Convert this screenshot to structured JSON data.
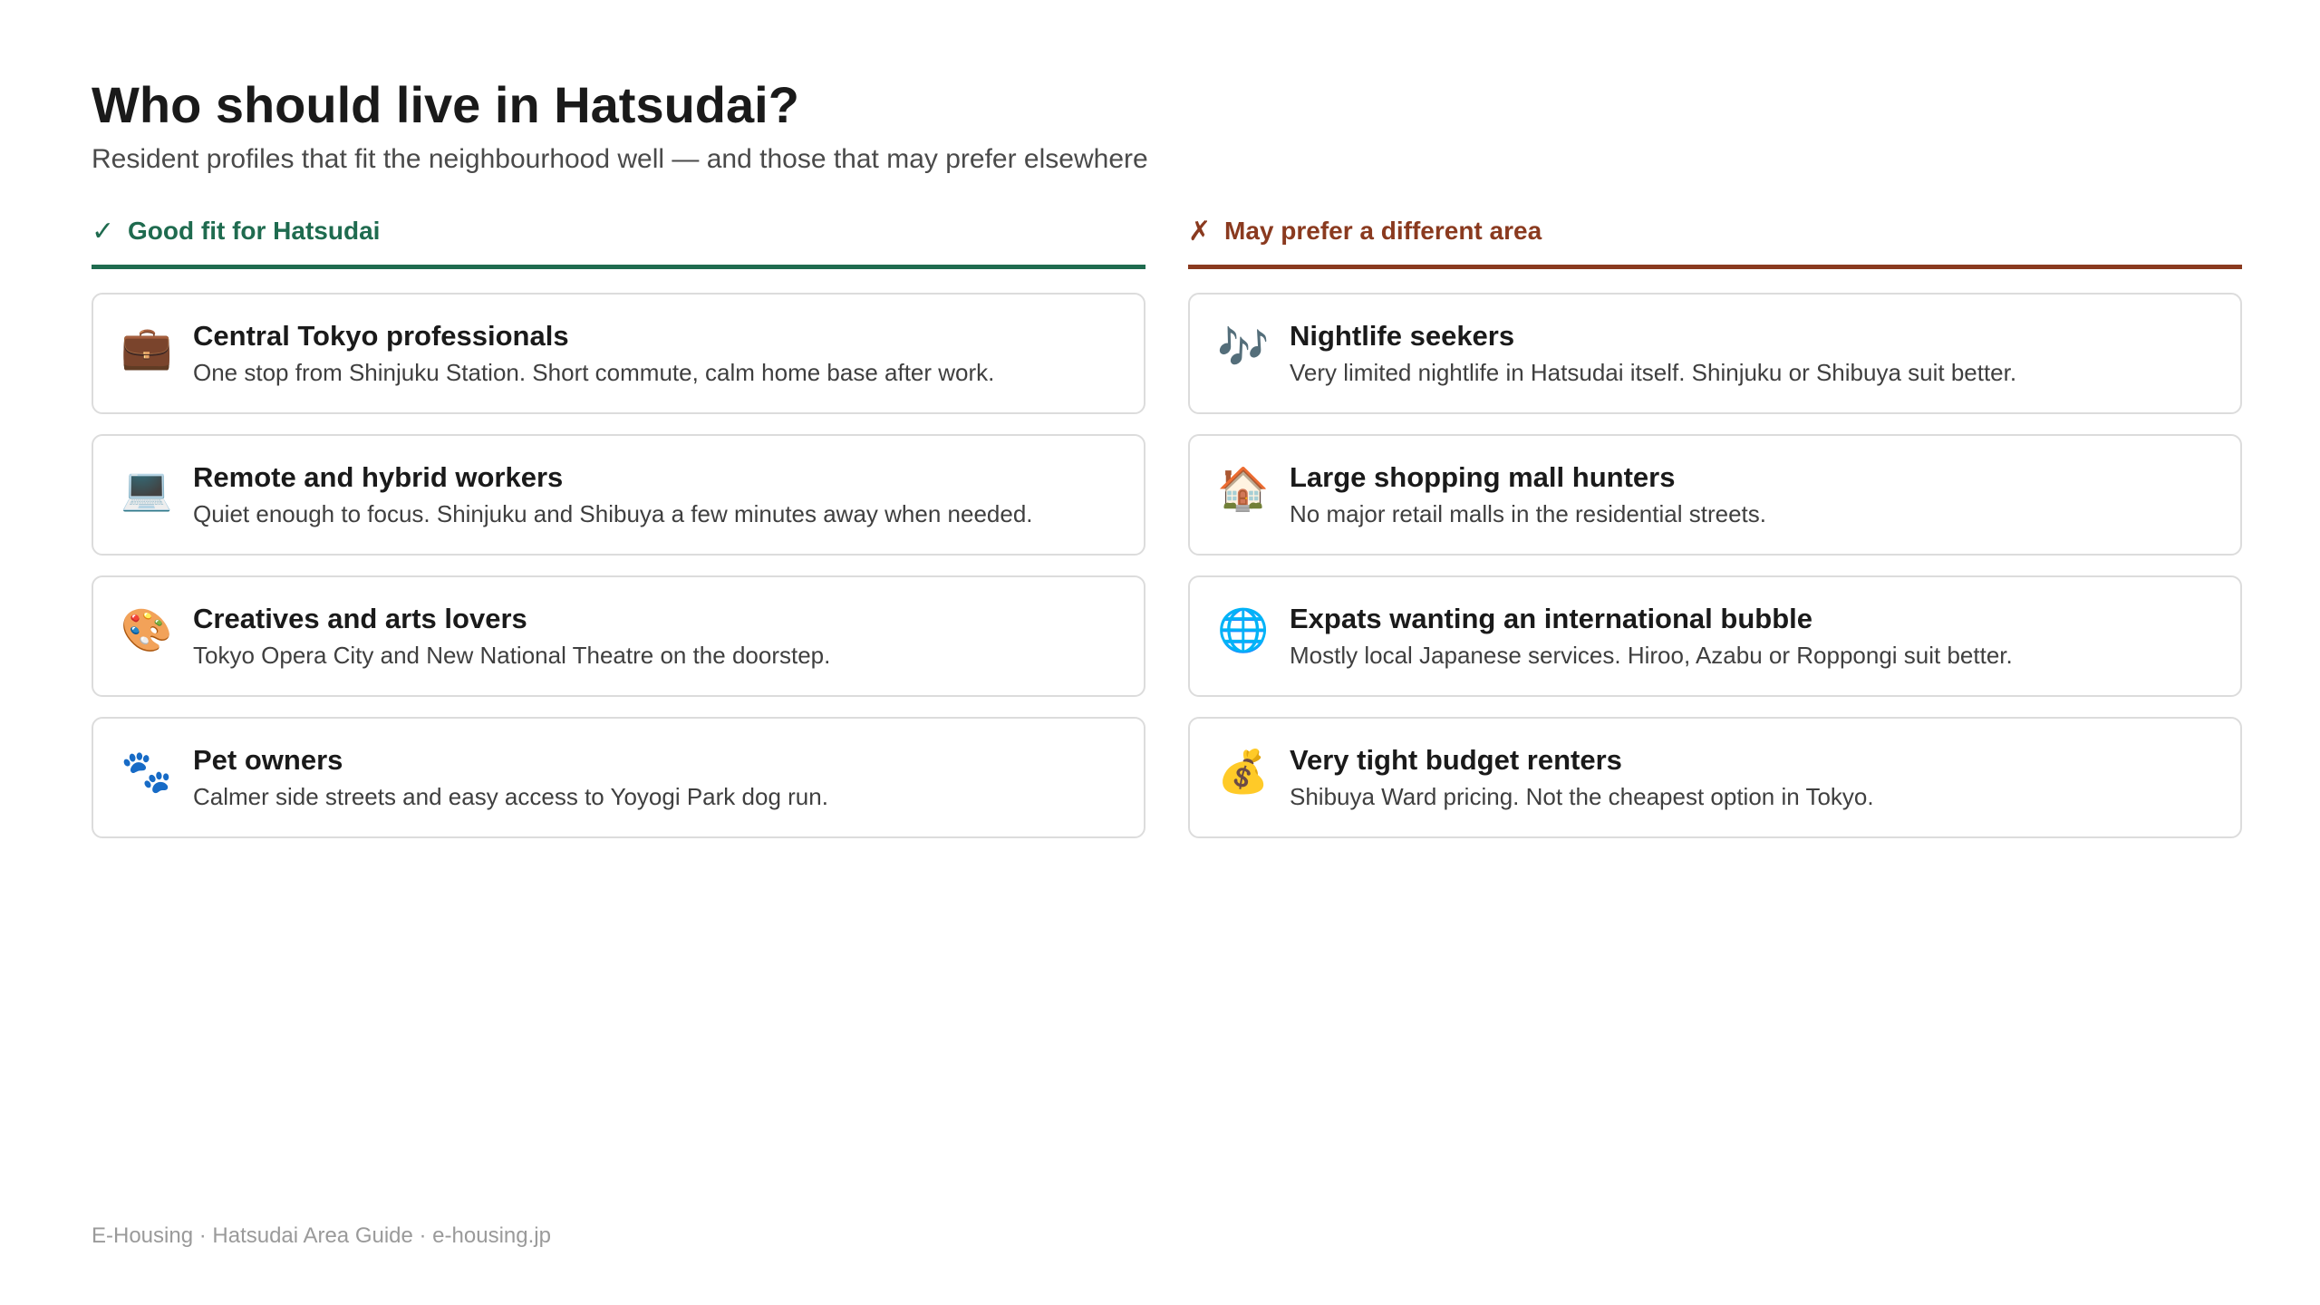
{
  "header": {
    "title": "Who should live in Hatsudai?",
    "subtitle": "Resident profiles that fit the neighbourhood well — and those that may prefer elsewhere"
  },
  "good_fit": {
    "mark": "✓",
    "heading": "Good fit for Hatsudai",
    "accent_color": "#1f6b4f",
    "items": [
      {
        "icon": "💼",
        "icon_name": "briefcase-icon",
        "title": "Central Tokyo professionals",
        "description": "One stop from Shinjuku Station. Short commute, calm home base after work."
      },
      {
        "icon": "💻",
        "icon_name": "laptop-icon",
        "title": "Remote and hybrid workers",
        "description": "Quiet enough to focus. Shinjuku and Shibuya a few minutes away when needed."
      },
      {
        "icon": "🎨",
        "icon_name": "palette-icon",
        "title": "Creatives and arts lovers",
        "description": "Tokyo Opera City and New National Theatre on the doorstep."
      },
      {
        "icon": "🐾",
        "icon_name": "paw-prints-icon",
        "title": "Pet owners",
        "description": "Calmer side streets and easy access to Yoyogi Park dog run."
      }
    ]
  },
  "bad_fit": {
    "mark": "✗",
    "heading": "May prefer a different area",
    "accent_color": "#8a3a1f",
    "items": [
      {
        "icon": "🎶",
        "icon_name": "music-notes-icon",
        "title": "Nightlife seekers",
        "description": "Very limited nightlife in Hatsudai itself. Shinjuku or Shibuya suit better."
      },
      {
        "icon": "🏠",
        "icon_name": "house-icon",
        "title": "Large shopping mall hunters",
        "description": "No major retail malls in the residential streets."
      },
      {
        "icon": "🌐",
        "icon_name": "globe-icon",
        "title": "Expats wanting an international bubble",
        "description": "Mostly local Japanese services. Hiroo, Azabu or Roppongi suit better."
      },
      {
        "icon": "💰",
        "icon_name": "money-bag-icon",
        "title": "Very tight budget renters",
        "description": "Shibuya Ward pricing. Not the cheapest option in Tokyo."
      }
    ]
  },
  "footer": {
    "text": "E-Housing · Hatsudai Area Guide · e-housing.jp"
  }
}
